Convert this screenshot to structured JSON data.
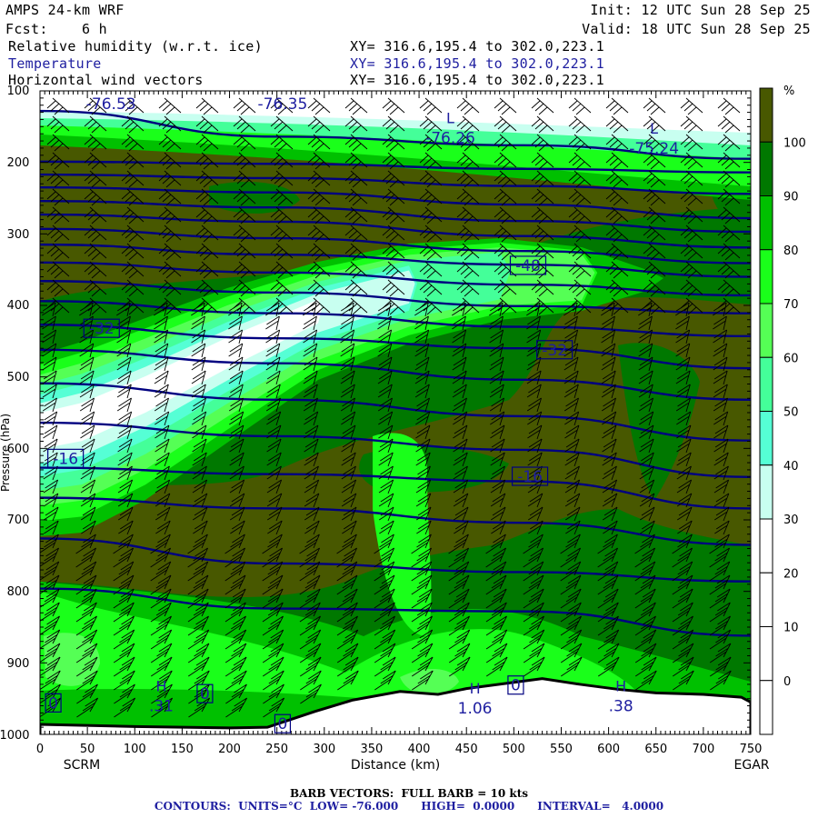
{
  "header": {
    "model": "AMPS 24-km WRF",
    "init": "Init: 12 UTC Sun 28 Sep 25",
    "fcst": "Fcst:    6 h",
    "valid": "Valid: 18 UTC Sun 28 Sep 25"
  },
  "fields": [
    {
      "name": "Relative humidity (w.r.t. ice)",
      "xy": "XY= 316.6,195.4 to 302.0,223.1"
    },
    {
      "name": "Temperature",
      "xy": "XY= 316.6,195.4 to 302.0,223.1"
    },
    {
      "name": "Horizontal wind vectors",
      "xy": "XY= 316.6,195.4 to 302.0,223.1"
    }
  ],
  "chart_data": {
    "type": "heatmap",
    "title": "AMPS 24-km WRF cross-section",
    "xlabel": "Distance (km)",
    "ylabel": "Pressure (hPa)",
    "xlim": [
      0,
      750
    ],
    "ylim": [
      1000,
      100
    ],
    "x_ticks": [
      "0",
      "50",
      "100",
      "150",
      "200",
      "250",
      "300",
      "350",
      "400",
      "450",
      "500",
      "550",
      "600",
      "650",
      "700",
      "750"
    ],
    "y_ticks": [
      "100",
      "200",
      "300",
      "400",
      "500",
      "600",
      "700",
      "800",
      "900",
      "1000"
    ],
    "endpoints": {
      "left": "SCRM",
      "right": "EGAR"
    },
    "colorbar": {
      "unit": "%",
      "labels": [
        "100",
        "90",
        "80",
        "70",
        "60",
        "50",
        "40",
        "30",
        "20",
        "10",
        "0"
      ],
      "bin_colors": [
        "#485800",
        "#007800",
        "#00c000",
        "#1aff1a",
        "#55ff55",
        "#44ff99",
        "#55ffd5",
        "#c8fff0",
        "#ffffff",
        "#ffffff",
        "#ffffff",
        "#ffffff"
      ]
    },
    "temperature_contours": {
      "units": "°C",
      "low": -76,
      "high": 0,
      "interval": 4,
      "color": "#000080",
      "distances_km": [
        0,
        250,
        510,
        750
      ],
      "lines": [
        {
          "level": -76,
          "p": [
            128,
            164,
            176,
            195
          ]
        },
        {
          "level": -72,
          "p": [
            199,
            202,
            209,
            214
          ]
        },
        {
          "level": -68,
          "p": [
            217,
            222,
            233,
            244
          ]
        },
        {
          "level": -64,
          "p": [
            235,
            242,
            259,
            278
          ]
        },
        {
          "level": -60,
          "p": [
            254,
            263,
            282,
            297
          ]
        },
        {
          "level": -56,
          "p": [
            273,
            283,
            303,
            319
          ]
        },
        {
          "level": -52,
          "p": [
            293,
            306,
            324,
            341
          ]
        },
        {
          "level": -48,
          "p": [
            315,
            329,
            343,
            360
          ]
        },
        {
          "level": -44,
          "p": [
            340,
            354,
            371,
            386
          ]
        },
        {
          "level": -40,
          "p": [
            366,
            382,
            401,
            411
          ]
        },
        {
          "level": -36,
          "p": [
            394,
            411,
            430,
            443
          ]
        },
        {
          "level": -32,
          "p": [
            427,
            446,
            460,
            488
          ]
        },
        {
          "level": -28,
          "p": [
            462,
            481,
            504,
            532
          ]
        },
        {
          "level": -24,
          "p": [
            509,
            532,
            555,
            589
          ]
        },
        {
          "level": -20,
          "p": [
            564,
            583,
            602,
            640
          ]
        },
        {
          "level": -16,
          "p": [
            627,
            636,
            646,
            684
          ]
        },
        {
          "level": -12,
          "p": [
            669,
            684,
            704,
            735
          ]
        },
        {
          "level": -8,
          "p": [
            726,
            761,
            773,
            786
          ]
        },
        {
          "level": -4,
          "p": [
            796,
            824,
            828,
            862
          ]
        }
      ],
      "labels": [
        {
          "text": "-32",
          "boxed": true,
          "x_km": 65,
          "p": 432
        },
        {
          "text": "-48",
          "boxed": true,
          "x_km": 515,
          "p": 344
        },
        {
          "text": "-32",
          "boxed": true,
          "x_km": 543,
          "p": 462
        },
        {
          "text": "-16",
          "boxed": true,
          "x_km": 27,
          "p": 614
        },
        {
          "text": "-16",
          "boxed": true,
          "x_km": 517,
          "p": 639
        },
        {
          "text": "0",
          "boxed": true,
          "x_km": 14,
          "p": 956
        },
        {
          "text": "0",
          "boxed": true,
          "x_km": 174,
          "p": 943
        },
        {
          "text": "0",
          "boxed": true,
          "x_km": 256,
          "p": 985
        },
        {
          "text": "0",
          "boxed": true,
          "x_km": 502,
          "p": 931
        }
      ],
      "extrema": [
        {
          "mark": "",
          "value": "-76.53",
          "x_km": 75,
          "p": 118
        },
        {
          "mark": "",
          "value": "-76.35",
          "x_km": 256,
          "p": 118
        },
        {
          "mark": "L",
          "value": "-76.26",
          "x_km": 433,
          "p": 155
        },
        {
          "mark": "L",
          "value": "-75.24",
          "x_km": 648,
          "p": 170
        },
        {
          "mark": "H",
          "value": ".31",
          "x_km": 128,
          "p": 950
        },
        {
          "mark": "H",
          "value": "1.06",
          "x_km": 459,
          "p": 953
        },
        {
          "mark": "H",
          "value": ".38",
          "x_km": 613,
          "p": 950
        }
      ]
    },
    "terrain": {
      "x_km": [
        0,
        100,
        200,
        240,
        290,
        330,
        380,
        420,
        450,
        490,
        530,
        570,
        610,
        650,
        700,
        740,
        750
      ],
      "p": [
        986,
        989,
        991,
        990,
        968,
        952,
        940,
        944,
        936,
        929,
        922,
        930,
        937,
        942,
        944,
        948,
        955
      ]
    }
  },
  "footer": {
    "barb": "BARB VECTORS:  FULL BARB = 10 kts",
    "contours": "CONTOURS:  UNITS=°C  LOW= -76.000      HIGH=  0.0000      INTERVAL=   4.0000"
  }
}
